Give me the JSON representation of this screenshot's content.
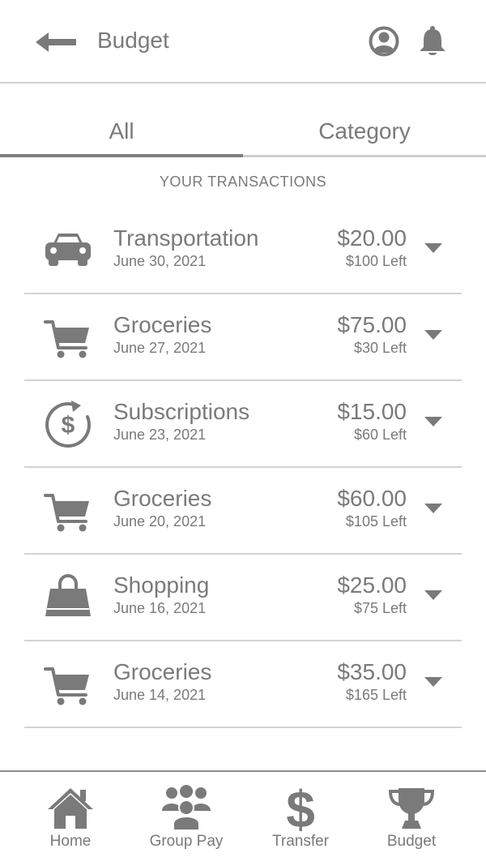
{
  "header": {
    "title": "Budget",
    "back_icon": "back-arrow-icon",
    "user_icon": "user-icon",
    "bell_icon": "bell-icon"
  },
  "tabs": [
    {
      "label": "All",
      "active": true
    },
    {
      "label": "Category",
      "active": false
    }
  ],
  "section_title": "YOUR TRANSACTIONS",
  "transactions": [
    {
      "name": "Transportation",
      "date": "June 30, 2021",
      "amount": "$20.00",
      "left": "$100 Left",
      "icon": "car-icon"
    },
    {
      "name": "Groceries",
      "date": "June 27, 2021",
      "amount": "$75.00",
      "left": "$30 Left",
      "icon": "cart-icon"
    },
    {
      "name": "Subscriptions",
      "date": "June 23, 2021",
      "amount": "$15.00",
      "left": "$60 Left",
      "icon": "recurring-dollar-icon"
    },
    {
      "name": "Groceries",
      "date": "June 20, 2021",
      "amount": "$60.00",
      "left": "$105 Left",
      "icon": "cart-icon"
    },
    {
      "name": "Shopping",
      "date": "June 16, 2021",
      "amount": "$25.00",
      "left": "$75 Left",
      "icon": "shopping-bag-icon"
    },
    {
      "name": "Groceries",
      "date": "June 14, 2021",
      "amount": "$35.00",
      "left": "$165 Left",
      "icon": "cart-icon"
    }
  ],
  "nav": [
    {
      "label": "Home",
      "icon": "home-icon"
    },
    {
      "label": "Group Pay",
      "icon": "group-icon"
    },
    {
      "label": "Transfer",
      "icon": "dollar-icon"
    },
    {
      "label": "Budget",
      "icon": "trophy-icon"
    }
  ],
  "colors": {
    "icon": "#7a7a7a",
    "divider": "#d3d3d3",
    "active_tab": "#7f7f7f"
  }
}
